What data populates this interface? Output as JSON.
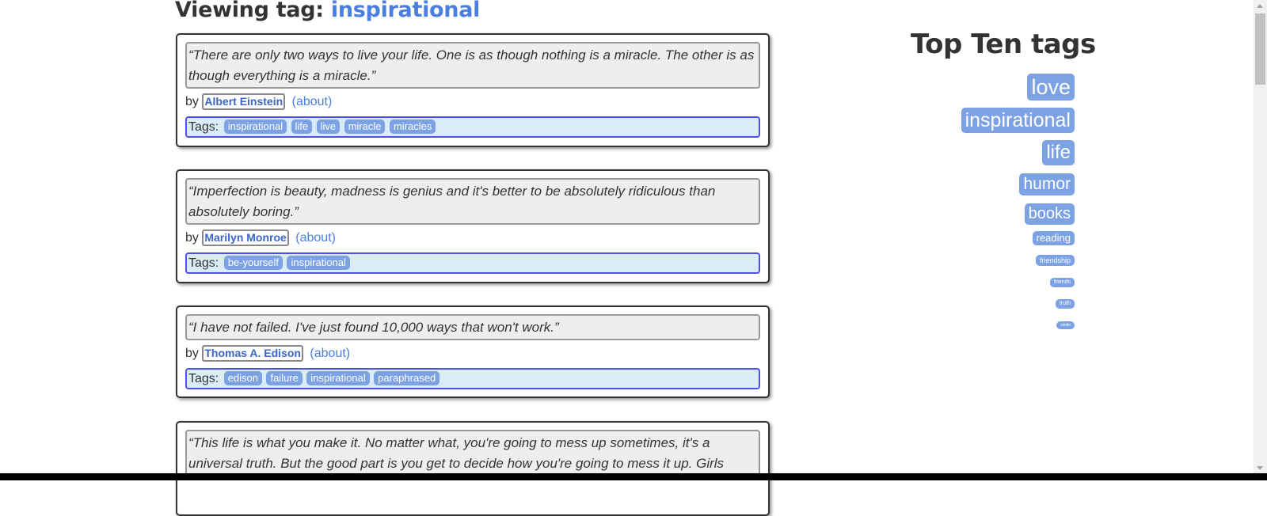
{
  "page": {
    "title_prefix": "Viewing tag:",
    "title_tag": "inspirational"
  },
  "quotes": [
    {
      "text": "“There are only two ways to live your life. One is as though nothing is a miracle. The other is as though everything is a miracle.”",
      "by_label": "by",
      "author": "Albert Einstein",
      "about": "(about)",
      "tags_label": "Tags:",
      "tags": [
        "inspirational",
        "life",
        "live",
        "miracle",
        "miracles"
      ]
    },
    {
      "text": "“Imperfection is beauty, madness is genius and it's better to be absolutely ridiculous than absolutely boring.”",
      "by_label": "by",
      "author": "Marilyn Monroe",
      "about": "(about)",
      "tags_label": "Tags:",
      "tags": [
        "be-yourself",
        "inspirational"
      ]
    },
    {
      "text": "“I have not failed. I've just found 10,000 ways that won't work.”",
      "by_label": "by",
      "author": "Thomas A. Edison",
      "about": "(about)",
      "tags_label": "Tags:",
      "tags": [
        "edison",
        "failure",
        "inspirational",
        "paraphrased"
      ]
    },
    {
      "text": "“This life is what you make it. No matter what, you're going to mess up sometimes, it's a universal truth. But the good part is you get to decide how you're going to mess it up. Girls"
    }
  ],
  "top_tags": {
    "title": "Top Ten tags",
    "items": [
      "love",
      "inspirational",
      "life",
      "humor",
      "books",
      "reading",
      "friendship",
      "friends",
      "truth",
      "simile"
    ]
  },
  "colors": {
    "accent": "#4a7fe0",
    "tag_bg": "#7ca2e4",
    "tags_box_bg": "#d9ecf7",
    "tags_box_border": "#4f4ff0"
  }
}
